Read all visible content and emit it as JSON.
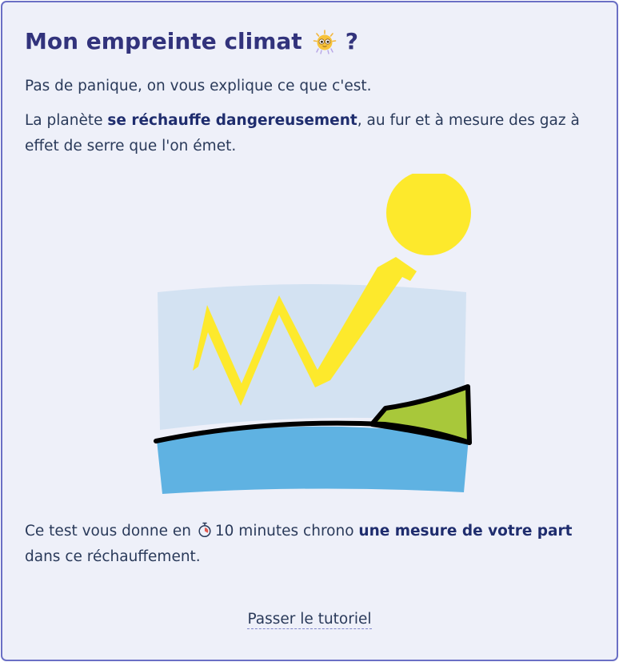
{
  "card": {
    "title": "Mon empreinte climat",
    "title_suffix": "?",
    "title_emoji": "hot-sun-face-icon",
    "intro": "Pas de panique, on vous explique ce que c'est.",
    "warming": {
      "before": "La planète ",
      "emphasis": "se réchauffe dangereusement",
      "after": ", au fur et à mesure des gaz à effet de serre que l'on émet."
    },
    "illustration": "sun-rays-hitting-earth-greenhouse-illustration",
    "test": {
      "before": "Ce test vous donne en ",
      "timer_icon": "stopwatch-icon",
      "duration": "10 minutes chrono ",
      "emphasis": "une mesure de votre part",
      "after": " dans ce réchauffement."
    },
    "skip_label": "Passer le tutoriel"
  },
  "colors": {
    "border": "#6a6fc5",
    "background": "#eef0f9",
    "title": "#32337c",
    "sun": "#fde92c",
    "sky": "#d3e2f2",
    "sea": "#5fb2e2",
    "land": "#a8c83a"
  }
}
